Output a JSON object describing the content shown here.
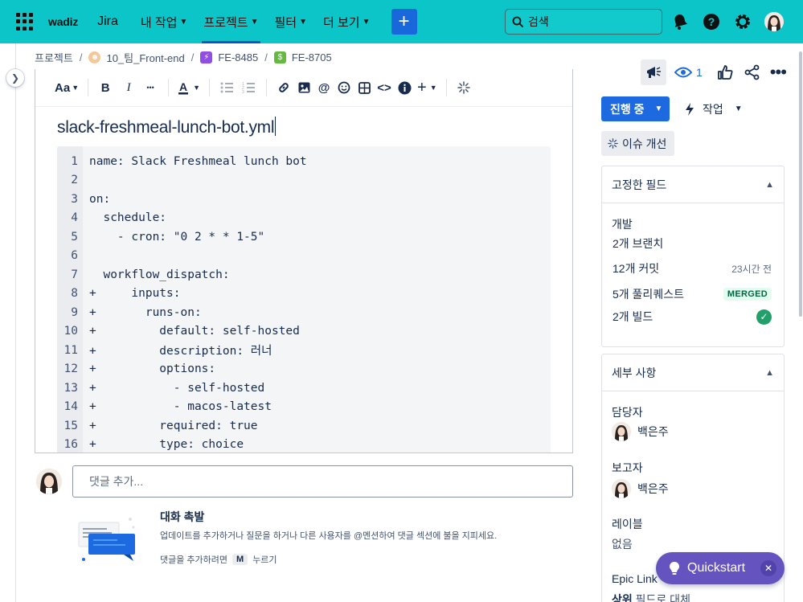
{
  "topnav": {
    "brand": "wadiz",
    "product": "Jira",
    "items": [
      {
        "label": "내 작업"
      },
      {
        "label": "프로젝트"
      },
      {
        "label": "필터"
      },
      {
        "label": "더 보기"
      }
    ],
    "create_label": "+",
    "search_placeholder": "검색",
    "bg_color": "#0bc5c8",
    "icons": [
      "notification-icon",
      "help-icon",
      "settings-icon"
    ]
  },
  "breadcrumb": {
    "items": [
      {
        "label": "프로젝트"
      },
      {
        "label": "10_팀_Front-end"
      },
      {
        "label": "FE-8485"
      },
      {
        "label": "FE-8705"
      }
    ]
  },
  "editor": {
    "toolbar": {
      "text_style_label": "Aa",
      "bold": "B",
      "italic": "I",
      "more": "•••"
    },
    "file_title": "slack-freshmeal-lunch-bot.yml",
    "code_lines": [
      {
        "n": "1",
        "text": "name: Slack Freshmeal lunch bot"
      },
      {
        "n": "2",
        "text": ""
      },
      {
        "n": "3",
        "text": "on:"
      },
      {
        "n": "4",
        "text": "  schedule:"
      },
      {
        "n": "5",
        "text": "    - cron: \"0 2 * * 1-5\""
      },
      {
        "n": "6",
        "text": ""
      },
      {
        "n": "7",
        "text": "  workflow_dispatch:"
      },
      {
        "n": "8",
        "text": "+     inputs:"
      },
      {
        "n": "9",
        "text": "+       runs-on:"
      },
      {
        "n": "10",
        "text": "+         default: self-hosted"
      },
      {
        "n": "11",
        "text": "+         description: 러너"
      },
      {
        "n": "12",
        "text": "+         options:"
      },
      {
        "n": "13",
        "text": "+           - self-hosted"
      },
      {
        "n": "14",
        "text": "+           - macos-latest"
      },
      {
        "n": "15",
        "text": "+         required: true"
      },
      {
        "n": "16",
        "text": "+         type: choice"
      }
    ]
  },
  "comments": {
    "placeholder": "댓글 추가...",
    "tip_title": "대화 촉발",
    "tip_body": "업데이트를 추가하거나 질문을 하거나 다른 사용자를 @멘션하여 댓글 섹션에 불을 지피세요.",
    "hint_prefix": "댓글을 추가하려면",
    "hint_key": "M",
    "hint_suffix": "누르기"
  },
  "issue_actions": {
    "watch_count": "1",
    "status_label": "진행 중",
    "workflow_label": "작업",
    "improve_label": "이슈 개선",
    "status_color": "#1d6ae0"
  },
  "pinned_fields": {
    "title": "고정한 필드",
    "dev_label": "개발",
    "rows": [
      {
        "label": "2개 브랜치",
        "meta": ""
      },
      {
        "label": "12개 커밋",
        "meta": "23시간 전"
      },
      {
        "label": "5개 풀리퀘스트",
        "meta": "MERGED"
      },
      {
        "label": "2개 빌드",
        "meta": ""
      }
    ]
  },
  "details": {
    "title": "세부 사항",
    "assignee_label": "담당자",
    "assignee": "백은주",
    "reporter_label": "보고자",
    "reporter": "백은주",
    "labels_label": "레이블",
    "labels_value": "없음",
    "epic_label": "Epic Link",
    "epic_value_prefix": "상위",
    "epic_value_suffix": "필드로 대체"
  },
  "quickstart": {
    "label": "Quickstart",
    "color": "#6554c0"
  }
}
